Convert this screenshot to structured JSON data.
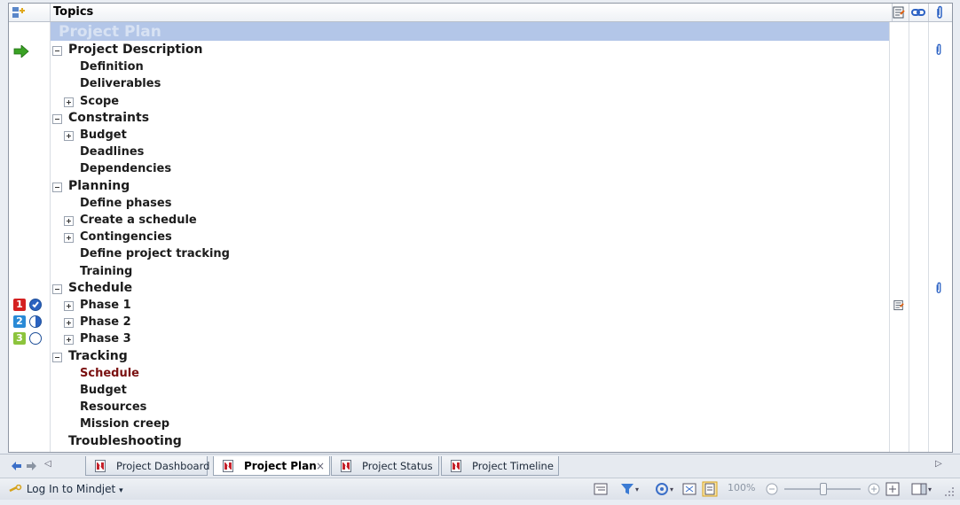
{
  "header": {
    "topics_label": "Topics"
  },
  "map_title": "Project Plan",
  "rows": [
    {
      "label": "Project Description",
      "level": 1,
      "expander": "minus"
    },
    {
      "label": "Definition",
      "level": 2,
      "expander": "none"
    },
    {
      "label": "Deliverables",
      "level": 2,
      "expander": "none"
    },
    {
      "label": "Scope",
      "level": 2,
      "expander": "plus"
    },
    {
      "label": "Constraints",
      "level": 1,
      "expander": "minus"
    },
    {
      "label": "Budget",
      "level": 2,
      "expander": "plus"
    },
    {
      "label": "Deadlines",
      "level": 2,
      "expander": "none"
    },
    {
      "label": "Dependencies",
      "level": 2,
      "expander": "none"
    },
    {
      "label": "Planning",
      "level": 1,
      "expander": "minus"
    },
    {
      "label": "Define phases",
      "level": 2,
      "expander": "none"
    },
    {
      "label": "Create a schedule",
      "level": 2,
      "expander": "plus"
    },
    {
      "label": "Contingencies",
      "level": 2,
      "expander": "plus"
    },
    {
      "label": "Define project tracking",
      "level": 2,
      "expander": "none"
    },
    {
      "label": "Training",
      "level": 2,
      "expander": "none"
    },
    {
      "label": "Schedule",
      "level": 1,
      "expander": "minus"
    },
    {
      "label": "Phase 1",
      "level": 2,
      "expander": "plus",
      "priority": "1",
      "progress": "complete"
    },
    {
      "label": "Phase 2",
      "level": 2,
      "expander": "plus",
      "priority": "2",
      "progress": "half"
    },
    {
      "label": "Phase 3",
      "level": 2,
      "expander": "plus",
      "priority": "3",
      "progress": "none"
    },
    {
      "label": "Tracking",
      "level": 1,
      "expander": "minus"
    },
    {
      "label": "Schedule",
      "level": 2,
      "expander": "none",
      "selected": true
    },
    {
      "label": "Budget",
      "level": 2,
      "expander": "none"
    },
    {
      "label": "Resources",
      "level": 2,
      "expander": "none"
    },
    {
      "label": "Mission creep",
      "level": 2,
      "expander": "none"
    },
    {
      "label": "Troubleshooting",
      "level": 1,
      "expander": "none"
    }
  ],
  "priority_colors": {
    "1": "#d42020",
    "2": "#2a8ad6",
    "3": "#8cc43c"
  },
  "accent": "#b3c6e8",
  "tabs": [
    {
      "label": "Project Dashboard",
      "active": false
    },
    {
      "label": "Project Plan",
      "active": true,
      "close": "×"
    },
    {
      "label": "Project Status",
      "active": false
    },
    {
      "label": "Project Timeline",
      "active": false
    }
  ],
  "status": {
    "login_label": "Log In to Mindjet",
    "zoom": "100%"
  },
  "icons": {
    "gutter_header": "add-topic-icon",
    "notes_header": "notes-icon",
    "links_header": "link-icon",
    "attachments_header": "paperclip-icon"
  }
}
